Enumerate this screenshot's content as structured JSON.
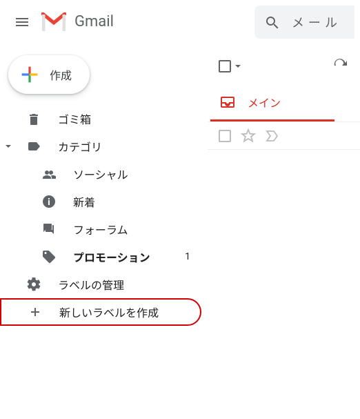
{
  "header": {
    "app_name": "Gmail",
    "search_placeholder": "メール"
  },
  "compose_label": "作成",
  "sidebar": {
    "trash_label": "ゴミ箱",
    "categories_label": "カテゴリ",
    "social_label": "ソーシャル",
    "updates_label": "新着",
    "forums_label": "フォーラム",
    "promotions_label": "プロモーション",
    "promotions_count": "1",
    "manage_labels_label": "ラベルの管理",
    "create_label_label": "新しいラベルを作成"
  },
  "tabs": {
    "primary_label": "メイン"
  }
}
